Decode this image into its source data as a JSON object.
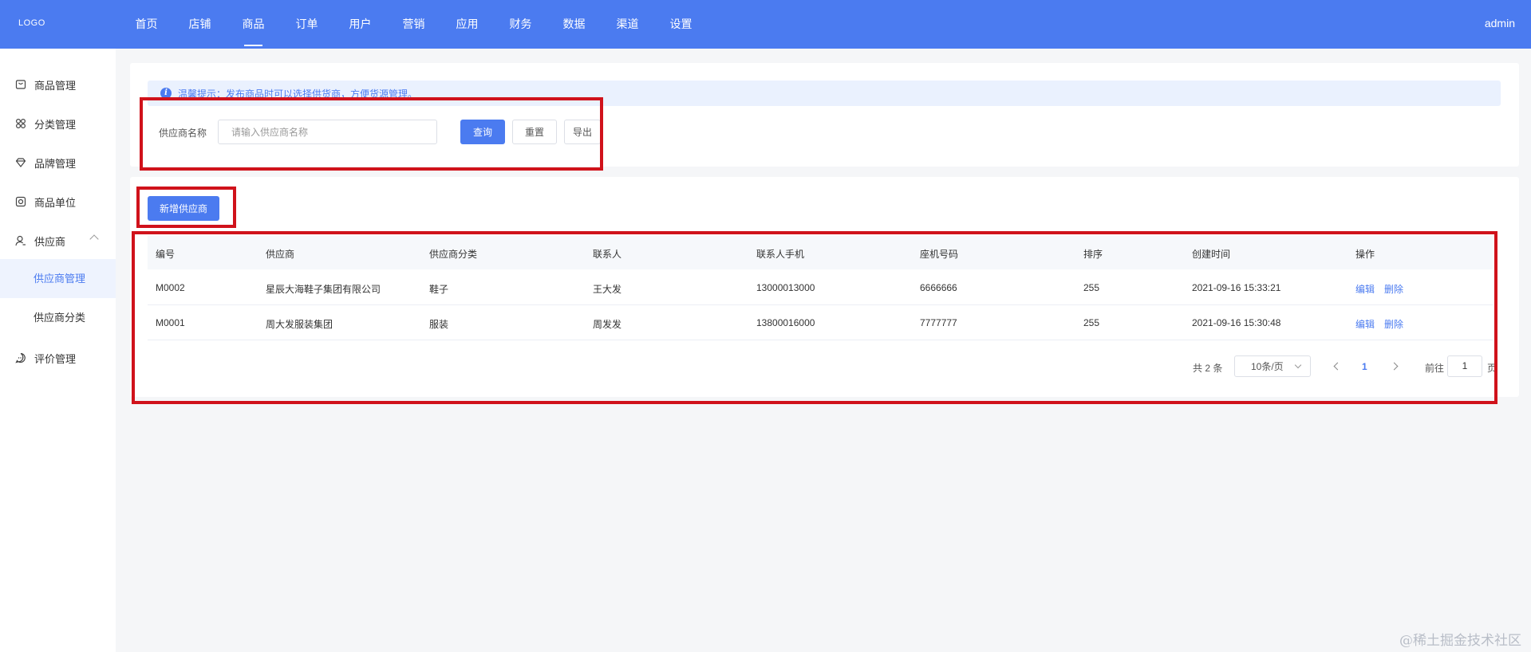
{
  "header": {
    "logo": "LOGO",
    "nav": [
      "首页",
      "店铺",
      "商品",
      "订单",
      "用户",
      "营销",
      "应用",
      "财务",
      "数据",
      "渠道",
      "设置"
    ],
    "active_nav": "商品",
    "user": "admin"
  },
  "sidebar": {
    "items": [
      {
        "label": "商品管理",
        "icon": "bag-icon"
      },
      {
        "label": "分类管理",
        "icon": "grid-icon"
      },
      {
        "label": "品牌管理",
        "icon": "diamond-icon"
      },
      {
        "label": "商品单位",
        "icon": "ruler-icon"
      },
      {
        "label": "供应商",
        "icon": "user-icon"
      },
      {
        "label": "评价管理",
        "icon": "chat-icon"
      }
    ],
    "sub_items": [
      "供应商管理",
      "供应商分类"
    ],
    "active_sub": "供应商管理"
  },
  "tip": {
    "text": "温馨提示：发布商品时可以选择供货商，方便货源管理。"
  },
  "search": {
    "label": "供应商名称",
    "placeholder": "请输入供应商名称",
    "query_button": "查询",
    "reset_button": "重置",
    "export_button": "导出"
  },
  "actions": {
    "add_button": "新增供应商"
  },
  "table": {
    "columns": [
      "编号",
      "供应商",
      "供应商分类",
      "联系人",
      "联系人手机",
      "座机号码",
      "排序",
      "创建时间",
      "操作"
    ],
    "rows": [
      {
        "id": "M0002",
        "supplier": "星辰大海鞋子集团有限公司",
        "category": "鞋子",
        "contact": "王大发",
        "mobile": "13000013000",
        "phone": "6666666",
        "sort": "255",
        "created": "2021-09-16 15:33:21"
      },
      {
        "id": "M0001",
        "supplier": "周大发服装集团",
        "category": "服装",
        "contact": "周发发",
        "mobile": "13800016000",
        "phone": "7777777",
        "sort": "255",
        "created": "2021-09-16 15:30:48"
      }
    ],
    "edit_label": "编辑",
    "delete_label": "删除"
  },
  "pagination": {
    "total": "共 2 条",
    "page_size": "10条/页",
    "current_page": "1",
    "goto_label": "前往",
    "goto_value": "1",
    "page_unit": "页"
  },
  "watermark": "@稀土掘金技术社区",
  "colors": {
    "primary": "#4b7bf0",
    "highlight_box": "#d0121b",
    "tip_bg": "#eaf1fe"
  }
}
